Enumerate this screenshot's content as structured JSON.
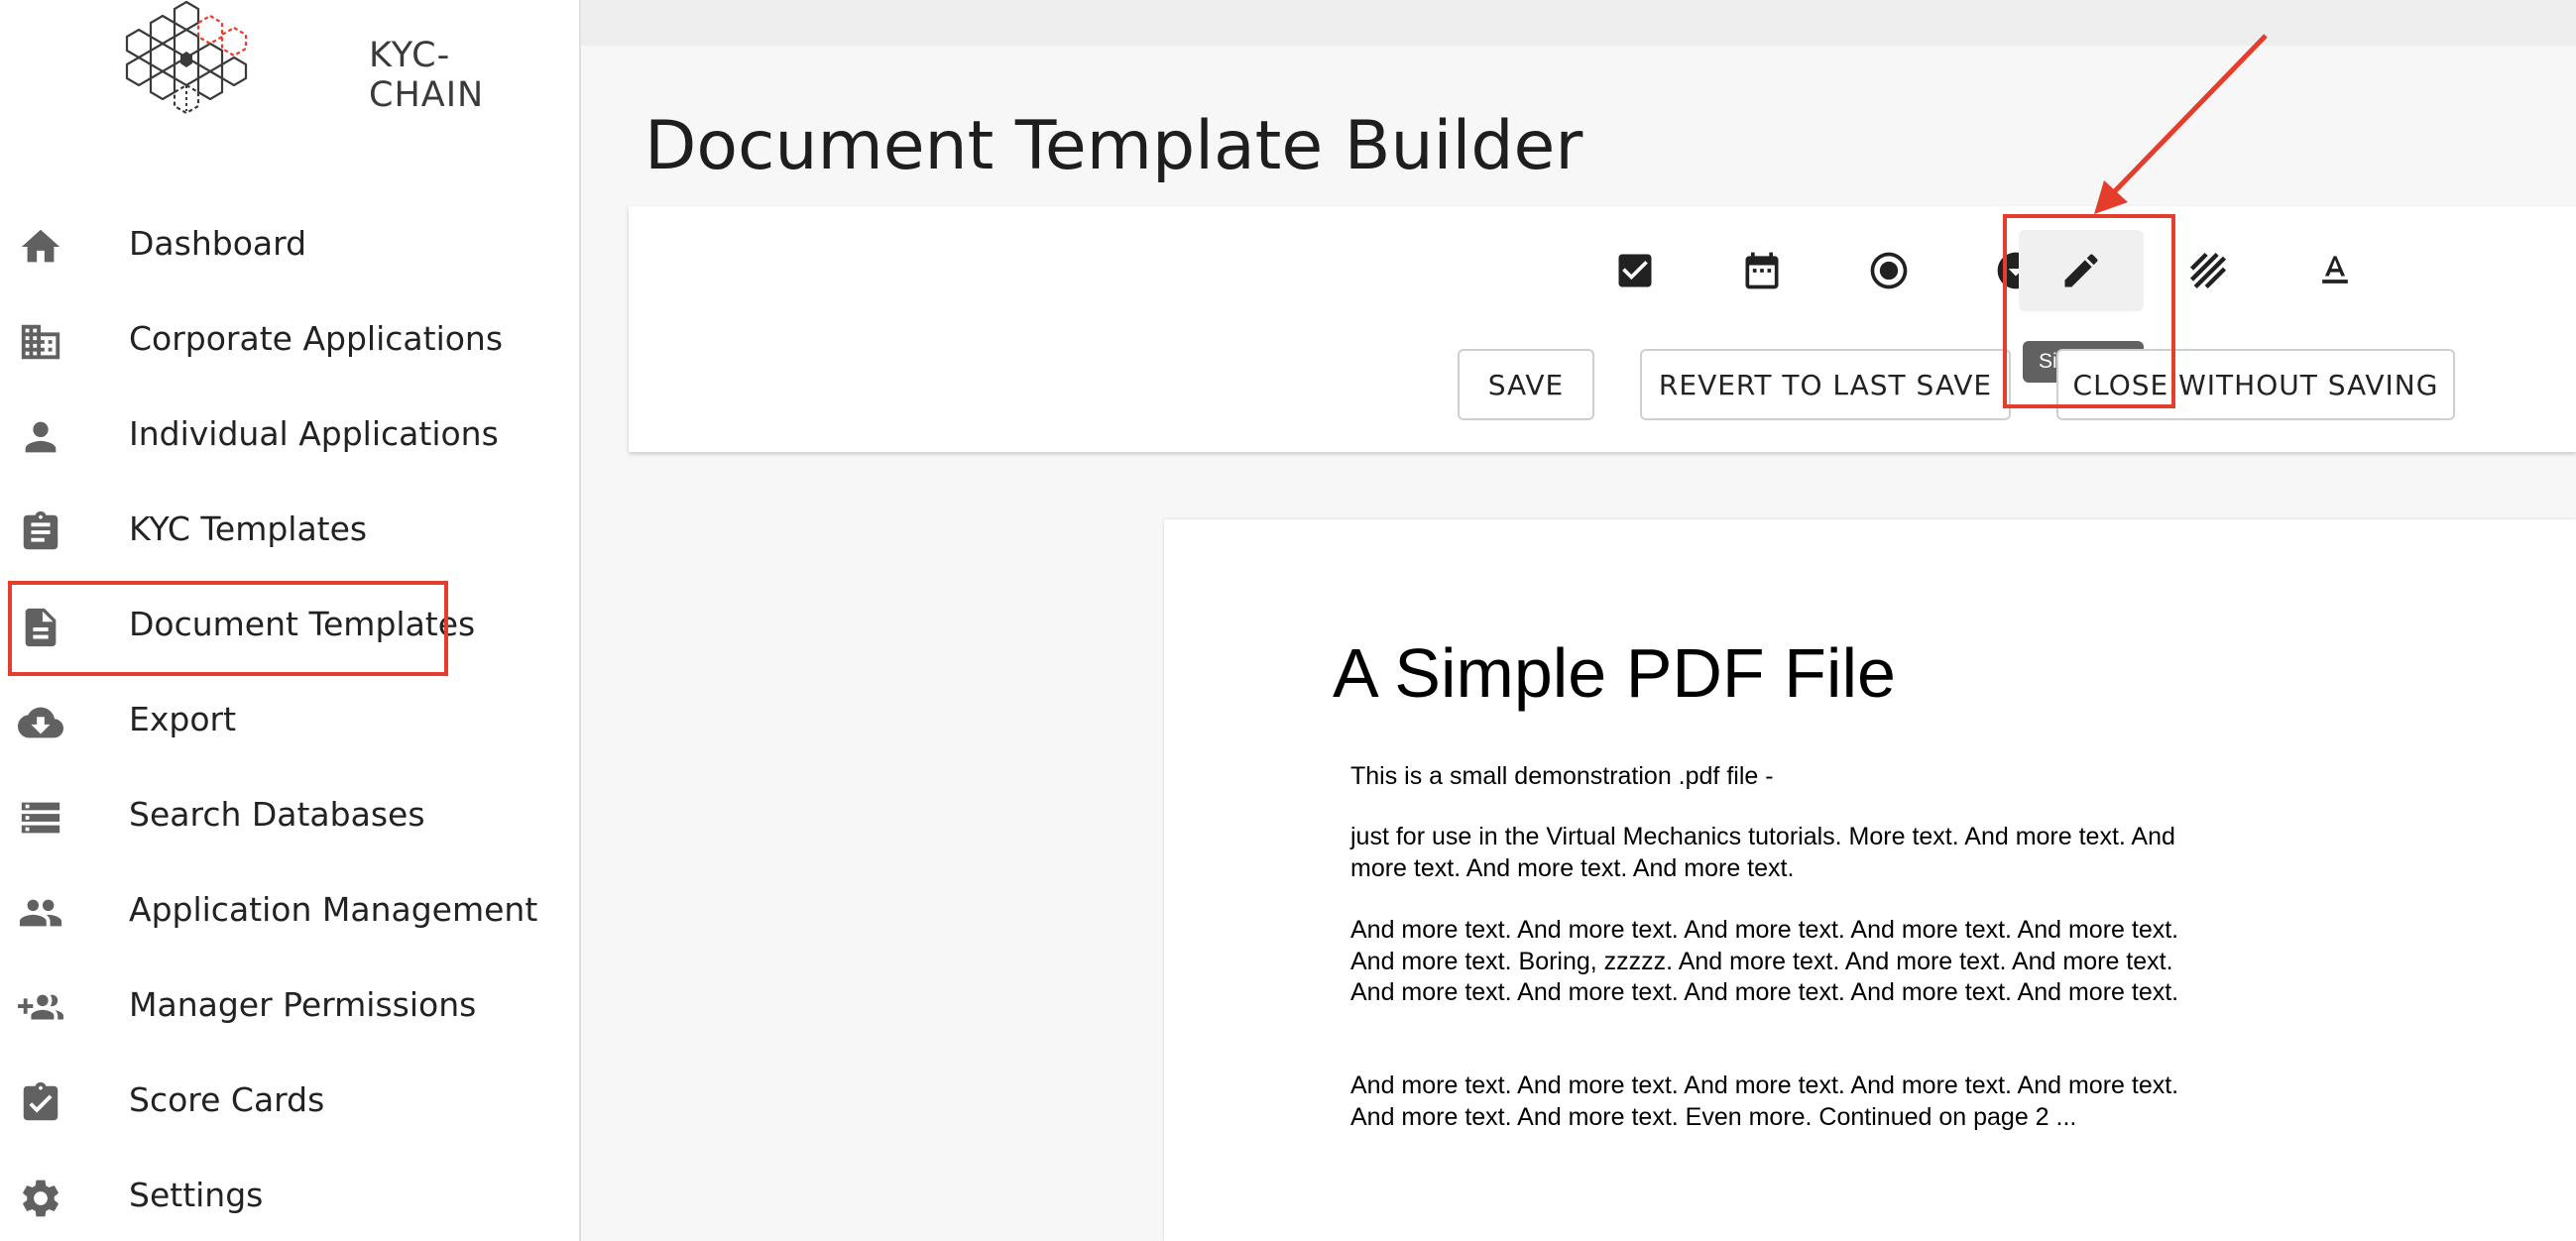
{
  "brand": {
    "logo_text": "KYC-CHAIN",
    "accent": "#e53d2b"
  },
  "sidebar": {
    "items": [
      {
        "label": "Dashboard",
        "icon": "home-icon"
      },
      {
        "label": "Corporate Applications",
        "icon": "building-icon"
      },
      {
        "label": "Individual Applications",
        "icon": "person-icon"
      },
      {
        "label": "KYC Templates",
        "icon": "clipboard-icon"
      },
      {
        "label": "Document Templates",
        "icon": "document-icon",
        "active": true
      },
      {
        "label": "Export",
        "icon": "cloud-download-icon"
      },
      {
        "label": "Search Databases",
        "icon": "storage-icon"
      },
      {
        "label": "Application Management",
        "icon": "people-icon"
      },
      {
        "label": "Manager Permissions",
        "icon": "group-add-icon"
      },
      {
        "label": "Score Cards",
        "icon": "assignment-check-icon"
      },
      {
        "label": "Settings",
        "icon": "gear-icon"
      }
    ]
  },
  "header": {
    "title": "Document Template Builder"
  },
  "toolbar": {
    "tools": [
      {
        "name": "checkbox",
        "icon": "checkbox-icon"
      },
      {
        "name": "date",
        "icon": "calendar-icon"
      },
      {
        "name": "radio",
        "icon": "radio-icon"
      },
      {
        "name": "dropdown",
        "icon": "dropdown-icon"
      },
      {
        "name": "signature",
        "icon": "pencil-icon",
        "active": true
      },
      {
        "name": "pattern",
        "icon": "hatch-icon"
      },
      {
        "name": "text",
        "icon": "text-format-icon"
      }
    ],
    "tooltip": "Signature",
    "save_label": "SAVE",
    "revert_label": "REVERT TO LAST SAVE",
    "close_label": "CLOSE WITHOUT SAVING"
  },
  "document": {
    "heading": "A Simple PDF File",
    "paragraphs": [
      "This is a small demonstration .pdf file -",
      "just for use in the Virtual Mechanics tutorials. More text. And more text. And more text. And more text. And more text.",
      "And more text. And more text. And more text. And more text. And more text. And more text. Boring, zzzzz. And more text. And more text. And more text. And more text. And more text. And more text. And more text. And more text.",
      "And more text. And more text. And more text. And more text. And more text. And more text. And more text. Even more. Continued on page 2 ..."
    ]
  }
}
